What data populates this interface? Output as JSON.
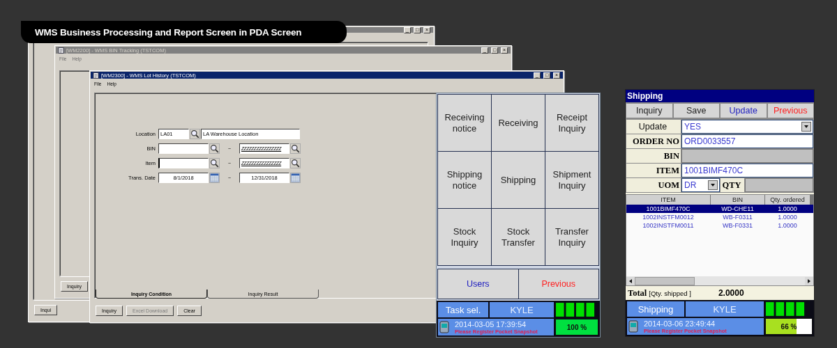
{
  "banner": "WMS Business Processing and Report Screen in PDA Screen",
  "windows": [
    {
      "active": false,
      "controls": [
        "_",
        "□",
        "×"
      ],
      "buttons": [
        {
          "label": "Inqui",
          "disabled": false
        }
      ]
    },
    {
      "title": "[WM2200] - WMS BIN Tracking (TSTCOM)",
      "active": false,
      "controls": [
        "_",
        "□",
        "×"
      ],
      "menu": [
        "File",
        "Help"
      ],
      "buttons": [
        {
          "label": "Inquiry",
          "disabled": false
        }
      ]
    },
    {
      "title": "[WM2300] - WMS Lot History (TSTCOM)",
      "active": true,
      "controls": [
        "_",
        "□",
        "×"
      ],
      "menu": [
        "File",
        "Help"
      ],
      "form": [
        {
          "kind": "lookup",
          "label": "Location",
          "value": "LA01",
          "name": "LA Warehouse Location"
        },
        {
          "kind": "range",
          "label": "BIN",
          "to": "ZZZZZZZZZZZZZZZZ",
          "separator": "~",
          "focused": false
        },
        {
          "kind": "range",
          "label": "Item",
          "to": "ZZZZZZZZZZZZZZZZ",
          "separator": "~",
          "focused": true
        },
        {
          "kind": "date_range",
          "label": "Trans. Date",
          "from": "8/1/2018",
          "to": "12/31/2018",
          "separator": "~"
        }
      ],
      "tabs": [
        {
          "label": "Inquiry Condition",
          "selected": true
        },
        {
          "label": "Inquiry Result",
          "selected": false
        }
      ],
      "buttons": [
        {
          "label": "Inquiry",
          "disabled": false
        },
        {
          "label": "Excel Download",
          "disabled": true
        },
        {
          "label": "Clear",
          "disabled": false
        }
      ]
    }
  ],
  "pda_menu": {
    "tiles": [
      "Receiving notice",
      "Receiving",
      "Receipt Inquiry",
      "Shipping notice",
      "Shipping",
      "Shipment Inquiry",
      "Stock Inquiry",
      "Stock Transfer",
      "Transfer Inquiry"
    ],
    "nav": [
      {
        "label": "Users",
        "color": "#2020c0"
      },
      {
        "label": "Previous",
        "color": "#ff2020"
      }
    ],
    "status": {
      "task": "Task sel.",
      "user": "KYLE",
      "datetime": "2014-03-05 17:39:54",
      "notice": "Please Register Pocket Snapshot",
      "battery": "100 %",
      "level": 1.0
    }
  },
  "pda_shipping": {
    "title": "Shipping",
    "toolbar": [
      {
        "label": "Inquiry",
        "color": "#222222"
      },
      {
        "label": "Save",
        "color": "#222222"
      },
      {
        "label": "Update",
        "color": "#2020c0"
      },
      {
        "label": "Previous",
        "color": "#ff2020"
      }
    ],
    "fields": [
      {
        "kind": "select",
        "label": "Update",
        "value": "YES"
      },
      {
        "kind": "text",
        "label": "ORDER NO",
        "value": "ORD0033557",
        "disabled": false
      },
      {
        "kind": "text",
        "label": "BIN",
        "disabled": true
      },
      {
        "kind": "text",
        "label": "ITEM",
        "value": "1001BIMF470C",
        "disabled": false
      },
      {
        "kind": "select_qty",
        "label": "UOM",
        "value": "DR",
        "qty_label": "QTY",
        "qty_disabled": true
      }
    ],
    "table": {
      "columns": [
        "ITEM",
        "BIN",
        "Qty. ordered"
      ],
      "rows": [
        {
          "cells": [
            "1001BIMF470C",
            "WD-CHE11",
            "1.0000"
          ],
          "selected": true
        },
        {
          "cells": [
            "1002INSTFM0012",
            "WB-F0311",
            "1.0000"
          ],
          "selected": false
        },
        {
          "cells": [
            "1002INSTFM0011",
            "WB-F0331",
            "1.0000"
          ],
          "selected": false
        }
      ]
    },
    "total": {
      "label": "Total",
      "field": "[Qty. shipped ]",
      "value": "2.0000"
    },
    "status": {
      "task": "Shipping",
      "user": "KYLE",
      "datetime": "2014-03-06 23:49:44",
      "notice": "Please Register Pocket Snapshot",
      "battery": "66 %",
      "level": 0.66
    }
  }
}
